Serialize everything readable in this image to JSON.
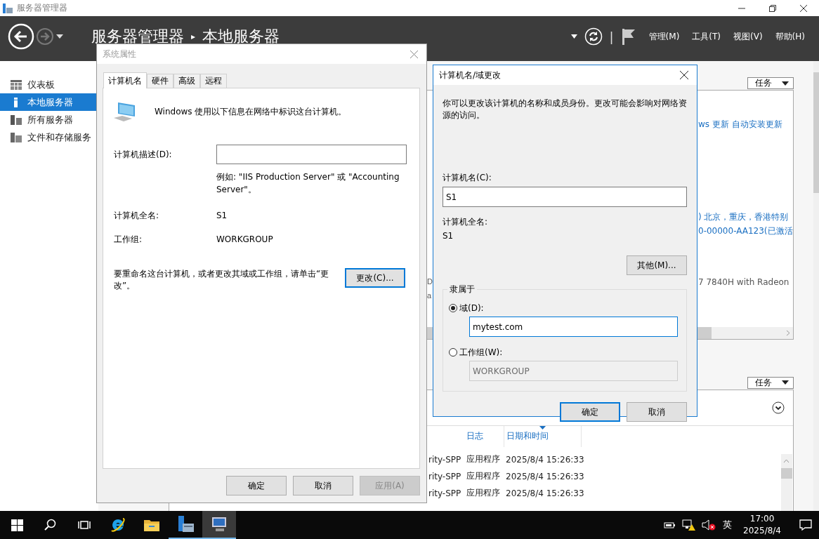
{
  "window": {
    "title": "服务器管理器"
  },
  "header": {
    "root": "服务器管理器",
    "separator": "▸",
    "current": "本地服务器",
    "divider": "|",
    "menus": [
      "管理(M)",
      "工具(T)",
      "视图(V)",
      "帮助(H)"
    ]
  },
  "sidebar": {
    "items": [
      {
        "label": "仪表板",
        "kind": "dashboard",
        "selected": false
      },
      {
        "label": "本地服务器",
        "kind": "local",
        "selected": true
      },
      {
        "label": "所有服务器",
        "kind": "all",
        "selected": false
      },
      {
        "label": "文件和存储服务",
        "kind": "files",
        "selected": false
      }
    ]
  },
  "properties": {
    "tasks": "任务",
    "column_1": [
      {
        "text": "D",
        "kind": "value"
      },
      {
        "text": "a",
        "kind": "value"
      }
    ],
    "column_2": [
      {
        "text": "ws 更新 自动安装更新",
        "kind": "link"
      },
      {
        "text": ") 北京，重庆，香港特别",
        "kind": "link"
      },
      {
        "text": "0-00000-AA123(已激活",
        "kind": "link"
      },
      {
        "text": "7 7840H with Radeon",
        "kind": "value"
      }
    ]
  },
  "events": {
    "tasks": "任务",
    "columns": [
      {
        "label": "日志",
        "sorted": false
      },
      {
        "label": "日期和时间",
        "sorted": true
      }
    ],
    "rows": [
      {
        "column_1": "rity-SPP",
        "log": "应用程序",
        "time": "2025/8/4 15:26:33"
      },
      {
        "column_1": "rity-SPP",
        "log": "应用程序",
        "time": "2025/8/4 15:26:33"
      },
      {
        "column_1": "rity-SPP",
        "log": "应用程序",
        "time": "2025/8/4 15:26:33"
      }
    ]
  },
  "system_properties": {
    "title": "系统属性",
    "active": false,
    "tabs": [
      {
        "label": "计算机名",
        "selected": true
      },
      {
        "label": "硬件",
        "selected": false
      },
      {
        "label": "高级",
        "selected": false
      },
      {
        "label": "远程",
        "selected": false
      }
    ],
    "intro": "Windows 使用以下信息在网络中标识这台计算机。",
    "description_label": "计算机描述(D):",
    "example": "例如: \"IIS Production Server\" 或 \"Accounting Server\"。",
    "full_name_label": "计算机全名:",
    "full_name": "S1",
    "workgroup_label": "工作组:",
    "workgroup": "WORKGROUP",
    "rename_hint": "要重命名这台计算机，或者更改其域或工作组，请单击“更改”。",
    "change_button": "更改(C)...",
    "buttons": [
      {
        "label": "确定",
        "disabled": false
      },
      {
        "label": "取消",
        "disabled": false
      },
      {
        "label": "应用(A)",
        "disabled": true
      }
    ]
  },
  "rename_dialog": {
    "title": "计算机名/域更改",
    "active": true,
    "description": "你可以更改该计算机的名称和成员身份。更改可能会影响对网络资源的访问。",
    "name_label": "计算机名(C):",
    "name_value": "S1",
    "full_name_label": "计算机全名:",
    "full_name": "S1",
    "more_button": "其他(M)...",
    "member_of": {
      "legend": "隶属于",
      "options": [
        {
          "label": "域(D):",
          "selected": true,
          "value": "mytest.com"
        },
        {
          "label": "工作组(W):",
          "selected": false,
          "value": "WORKGROUP"
        }
      ]
    },
    "buttons": [
      {
        "label": "确定",
        "default": true
      },
      {
        "label": "取消",
        "default": false
      }
    ]
  },
  "taskbar": {
    "apps": [
      {
        "kind": "ie",
        "running": false,
        "selected": false
      },
      {
        "kind": "explorer",
        "running": false,
        "selected": false
      },
      {
        "kind": "server",
        "running": true,
        "selected": false
      },
      {
        "kind": "system",
        "running": true,
        "selected": true
      }
    ],
    "ime": "英",
    "time": "17:00",
    "date": "2025/8/4"
  }
}
